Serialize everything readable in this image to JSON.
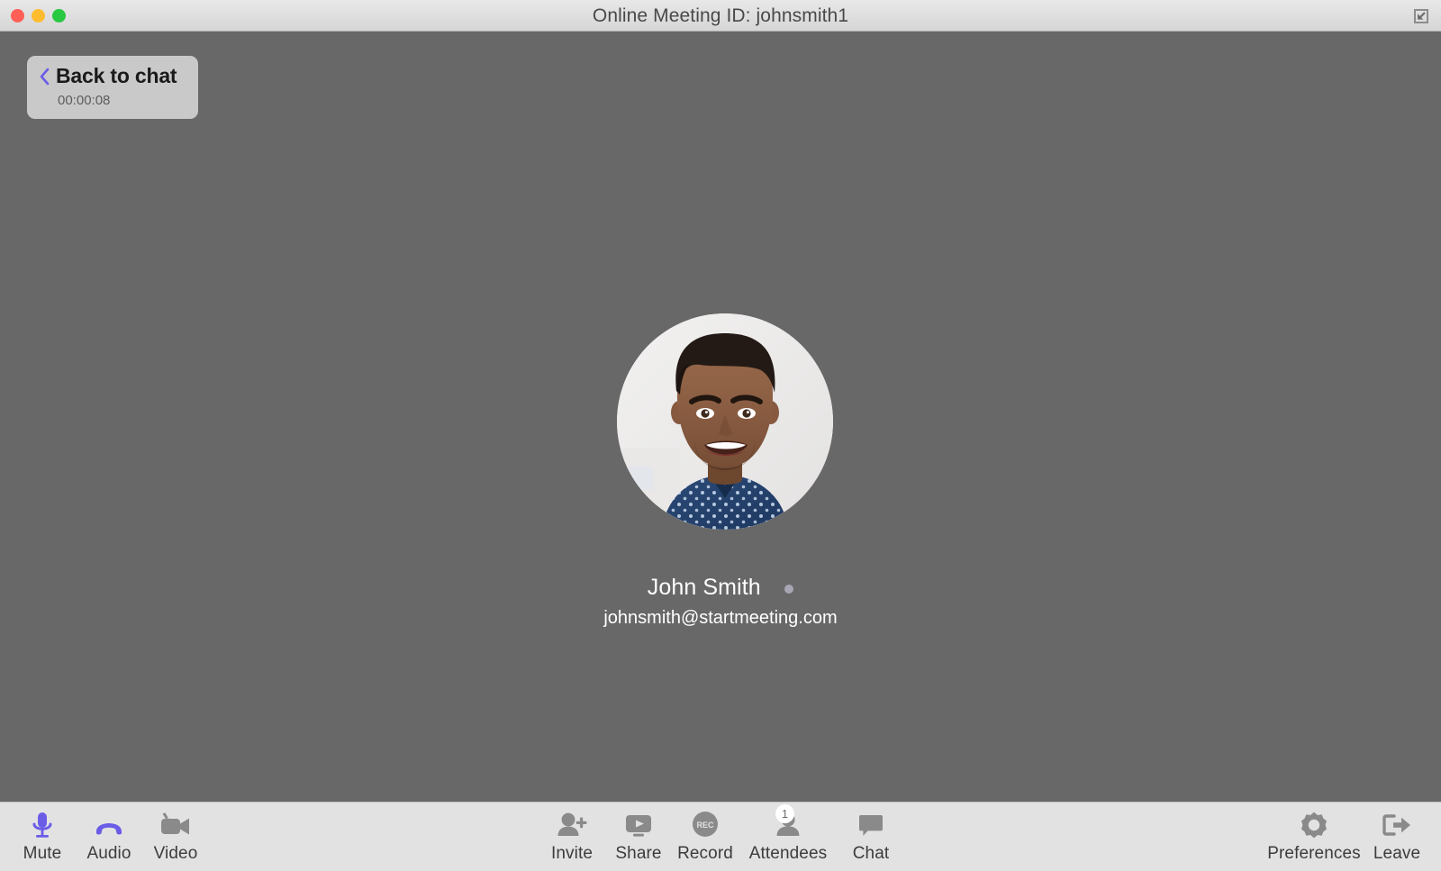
{
  "window": {
    "title": "Online Meeting ID: johnsmith1",
    "restore_icon": "exit-fullscreen-icon",
    "traffic_lights": [
      {
        "name": "close",
        "color": "#ff5f57"
      },
      {
        "name": "minimize",
        "color": "#febc2e"
      },
      {
        "name": "maximize",
        "color": "#28c840"
      }
    ]
  },
  "stage": {
    "back_to_chat": {
      "label": "Back to chat",
      "timer": "00:00:08",
      "chevron_icon": "chevron-left-icon",
      "chevron_color": "#6b5ce7"
    },
    "participant": {
      "name": "John Smith",
      "email": "johnsmith@startmeeting.com",
      "status_color": "#a8a6b4",
      "avatar_icon": "user-photo-avatar"
    },
    "background_color": "#686868"
  },
  "toolbar": {
    "left": [
      {
        "label": "Mute",
        "icon": "microphone-icon",
        "color": "#6b5ce7"
      },
      {
        "label": "Audio",
        "icon": "phone-handset-icon",
        "color": "#6b5ce7"
      },
      {
        "label": "Video",
        "icon": "video-camera-icon",
        "color": "#8a8a8a"
      }
    ],
    "center": [
      {
        "label": "Invite",
        "icon": "person-add-icon",
        "color": "#8a8a8a"
      },
      {
        "label": "Share",
        "icon": "screen-share-icon",
        "color": "#8a8a8a"
      },
      {
        "label": "Record",
        "icon": "record-icon",
        "color": "#8a8a8a"
      },
      {
        "label": "Attendees",
        "icon": "person-icon",
        "color": "#8a8a8a",
        "badge": "1"
      },
      {
        "label": "Chat",
        "icon": "chat-bubble-icon",
        "color": "#8a8a8a"
      }
    ],
    "right": [
      {
        "label": "Preferences",
        "icon": "gear-icon",
        "color": "#8a8a8a"
      },
      {
        "label": "Leave",
        "icon": "exit-arrow-icon",
        "color": "#8a8a8a"
      }
    ]
  }
}
